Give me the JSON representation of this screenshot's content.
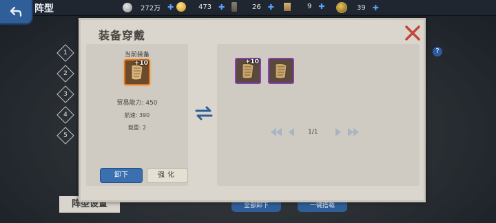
{
  "header": {
    "title": "阵型",
    "resources": [
      {
        "icon": "silver-coin-icon",
        "value": "272万"
      },
      {
        "icon": "gold-coin-icon",
        "value": "473"
      },
      {
        "icon": "scroll-icon",
        "value": "26"
      },
      {
        "icon": "map-icon",
        "value": "9"
      },
      {
        "icon": "medal-icon",
        "value": "39"
      }
    ]
  },
  "side_tabs": [
    "1",
    "2",
    "3",
    "4",
    "5"
  ],
  "bottom": {
    "tab_label": "阵型设置",
    "unload_all": "全部卸下",
    "one_click": "一键搭载"
  },
  "dialog": {
    "title": "装备穿戴",
    "current_label": "当前装备",
    "current_item": {
      "icon": "sail-icon",
      "level": "+10",
      "rarity": "orange"
    },
    "stats": {
      "trade": "贸易能力: 450",
      "speed": "航速: 390",
      "load": "载重: 2"
    },
    "unload_label": "卸下",
    "enhance_label": "强化",
    "inventory": [
      {
        "icon": "sail-icon",
        "level": "+10",
        "rarity": "purple"
      },
      {
        "icon": "sail-icon",
        "level": "",
        "rarity": "purple"
      }
    ],
    "page": "1/1"
  },
  "colors": {
    "accent_blue": "#3a6fb0",
    "orange_rarity": "#e07a1e",
    "purple_rarity": "#8a3db8",
    "close_red": "#c2463a"
  }
}
